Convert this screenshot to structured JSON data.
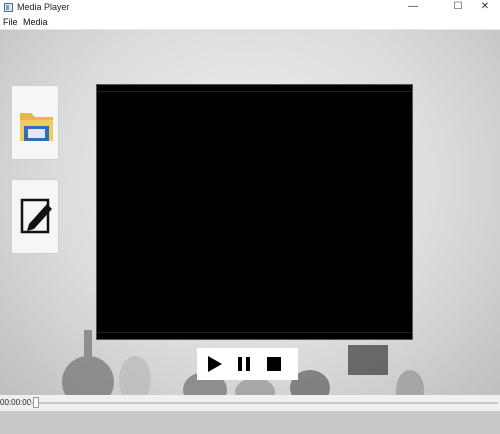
{
  "window": {
    "title": "Media Player",
    "minimize": "—",
    "maximize": "☐",
    "close": "✕"
  },
  "menu": [
    "File",
    "Media"
  ],
  "side_buttons": [
    {
      "name": "open-file-button",
      "icon": "folder-icon"
    },
    {
      "name": "edit-button",
      "icon": "edit-icon"
    }
  ],
  "controls": [
    "play-icon",
    "pause-icon",
    "stop-icon"
  ],
  "timeline": {
    "time": "00:00:00",
    "progress": 0.0
  },
  "colors": {
    "folder": "#e6b84a",
    "folder_blue": "#2f6fb8",
    "video_bg": "#000000"
  }
}
